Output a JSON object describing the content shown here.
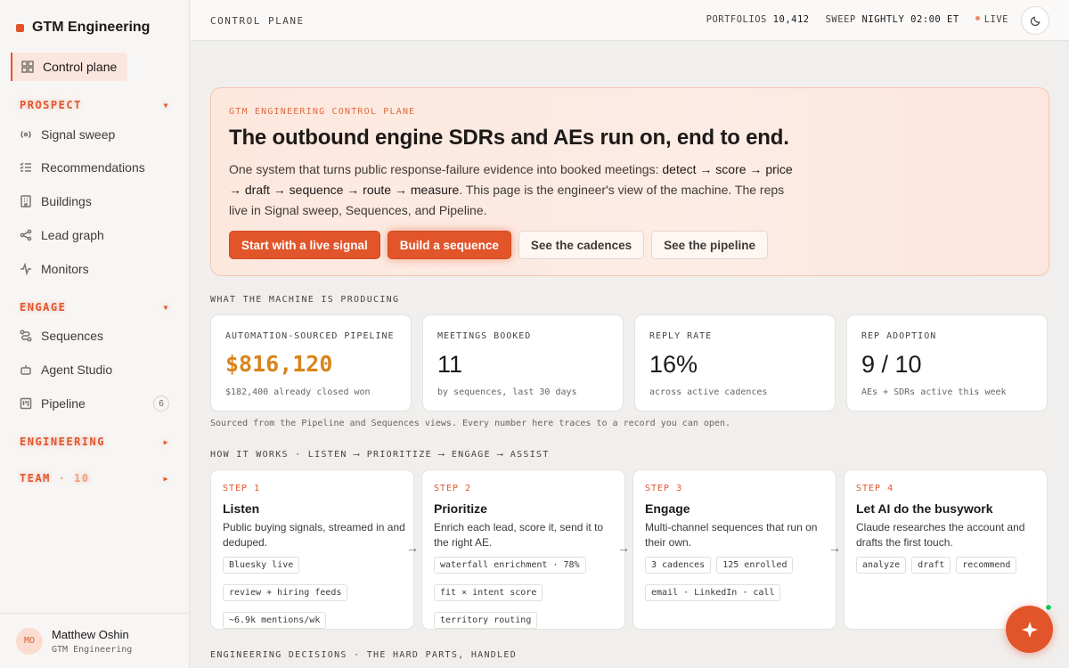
{
  "brand": {
    "name": "GTM Engineering",
    "accent": "#e2552b"
  },
  "sidebar": {
    "active": {
      "label": "Control plane",
      "icon": "grid-icon"
    },
    "sections": [
      {
        "title": "PROSPECT",
        "items": [
          {
            "label": "Signal sweep",
            "icon": "signal-icon"
          },
          {
            "label": "Recommendations",
            "icon": "list-check-icon"
          },
          {
            "label": "Buildings",
            "icon": "building-icon"
          },
          {
            "label": "Lead graph",
            "icon": "share-icon"
          },
          {
            "label": "Monitors",
            "icon": "pulse-icon"
          }
        ]
      },
      {
        "title": "ENGAGE",
        "items": [
          {
            "label": "Sequences",
            "icon": "route-icon"
          },
          {
            "label": "Agent Studio",
            "icon": "bot-icon"
          },
          {
            "label": "Pipeline",
            "icon": "kanban-icon",
            "badge": "6"
          }
        ]
      },
      {
        "title": "ENGINEERING"
      },
      {
        "title": "TEAM",
        "count": "10"
      }
    ],
    "user": {
      "initials": "MO",
      "name": "Matthew Oshin",
      "org": "GTM Engineering"
    }
  },
  "topbar": {
    "crumb": "CONTROL PLANE",
    "portfolios_label": "PORTFOLIOS",
    "portfolios_value": "10,412",
    "sweep_label": "SWEEP",
    "sweep_value": "NIGHTLY 02:00 ET",
    "live_label": "LIVE"
  },
  "hero": {
    "eyebrow": "GTM ENGINEERING CONTROL PLANE",
    "title": "The outbound engine SDRs and AEs run on, end to end.",
    "body_start": "One system that turns public response-failure evidence into booked meetings: ",
    "body_flow": "detect → score → price → draft → sequence → route → measure",
    "body_end": ". This page is the engineer's view of the machine. The reps live in Signal sweep, Sequences, and Pipeline.",
    "buttons": [
      "Start with a live signal",
      "Build a sequence",
      "See the cadences",
      "See the pipeline"
    ]
  },
  "metrics_section": {
    "label": "WHAT THE MACHINE IS PRODUCING",
    "cards": [
      {
        "label": "AUTOMATION-SOURCED PIPELINE",
        "value": "$816,120",
        "sub": "$182,400 already closed won"
      },
      {
        "label": "MEETINGS BOOKED",
        "value": "11",
        "sub": "by sequences, last 30 days"
      },
      {
        "label": "REPLY RATE",
        "value": "16%",
        "sub": "across active cadences"
      },
      {
        "label": "REP ADOPTION",
        "value": "9 / 10",
        "sub": "AEs + SDRs active this week"
      }
    ],
    "footnote": "Sourced from the Pipeline and Sequences views. Every number here traces to a record you can open."
  },
  "steps_section": {
    "label": "HOW IT WORKS · LISTEN ⟶ PRIORITIZE ⟶ ENGAGE ⟶ ASSIST",
    "steps": [
      {
        "num": "STEP 1",
        "title": "Listen",
        "desc": "Public buying signals, streamed in and deduped.",
        "chips": [
          "Bluesky live",
          "review + hiring feeds",
          "~6.9k mentions/wk"
        ]
      },
      {
        "num": "STEP 2",
        "title": "Prioritize",
        "desc": "Enrich each lead, score it, send it to the right AE.",
        "chips": [
          "waterfall enrichment · 78%",
          "fit × intent score",
          "territory routing"
        ]
      },
      {
        "num": "STEP 3",
        "title": "Engage",
        "desc": "Multi-channel sequences that run on their own.",
        "chips": [
          "3 cadences",
          "125 enrolled",
          "email · LinkedIn · call"
        ]
      },
      {
        "num": "STEP 4",
        "title": "Let AI do the busywork",
        "desc": "Claude researches the account and drafts the first touch.",
        "chips": [
          "analyze",
          "draft",
          "recommend"
        ]
      }
    ],
    "arrow": "→"
  },
  "decisions_section": {
    "label": "ENGINEERING DECISIONS · THE HARD PARTS, HANDLED"
  },
  "assistant": {
    "icon": "sparkle-icon"
  }
}
